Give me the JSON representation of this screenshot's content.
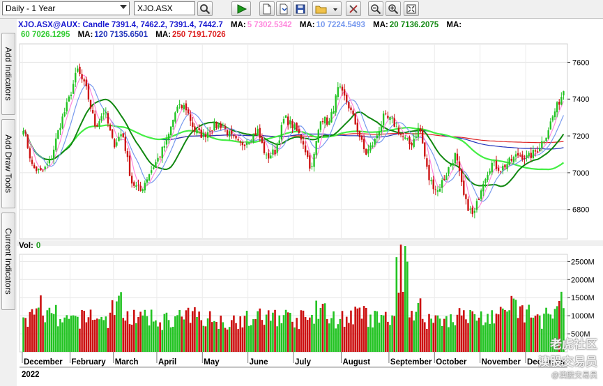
{
  "toolbar": {
    "period": "Daily - 1 Year",
    "symbol": "XJO.ASX"
  },
  "sidebar": {
    "tab1": "Add Indicators",
    "tab2": "Add Draw Tools",
    "tab3": "Current Indicators"
  },
  "legend": {
    "price": "XJO.ASX@AUX: Candle 7391.4, 7462.2, 7391.4, 7442.7",
    "ma5_label": "MA:",
    "ma5_value": "5 7302.5342",
    "ma10_label": "MA:",
    "ma10_value": "10 7224.5493",
    "ma20_label": "MA:",
    "ma20_value": "20 7136.2075",
    "ma_extra_label": "MA:",
    "ma60_value": "60 7026.1295",
    "ma120_label": "MA:",
    "ma120_value": "120 7135.6501",
    "ma250_label": "MA:",
    "ma250_value": "250 7191.7026",
    "volume": "Vol:",
    "volume_value": "0"
  },
  "watermark": {
    "text1": "老虎社区",
    "text2": "澳股交易员",
    "text3": "@澳股交易员"
  },
  "colors": {
    "up": "#22c322",
    "down": "#cc1111",
    "ma5": "#ff88dd",
    "ma10": "#7799ee",
    "ma20": "#118811",
    "ma60": "#44ee44",
    "ma120": "#2233bb",
    "ma250": "#dd2222"
  },
  "chart_data": {
    "type": "candlestick",
    "price_axis_ticks": [
      "7600",
      "7400",
      "7200",
      "7000",
      "6800"
    ],
    "price_axis_values": [
      7600,
      7400,
      7200,
      7000,
      6800
    ],
    "ylim": [
      6640,
      7700
    ],
    "volume_axis_ticks": [
      "2500M",
      "2000M",
      "1500M",
      "1000M",
      "500M"
    ],
    "volume_axis_values": [
      2500,
      2000,
      1500,
      1000,
      500
    ],
    "volume_ylim": [
      0,
      2700
    ],
    "months": [
      "December",
      "February",
      "March",
      "April",
      "May",
      "June",
      "July",
      "August",
      "September",
      "October",
      "November",
      "December"
    ],
    "year_label": "2022",
    "close_anchors": [
      7250,
      7030,
      7000,
      7060,
      7250,
      7390,
      7560,
      7450,
      7250,
      7340,
      7150,
      7220,
      6950,
      6900,
      7000,
      7080,
      7180,
      7350,
      7360,
      7230,
      7200,
      7250,
      7260,
      7200,
      7150,
      7180,
      7230,
      7080,
      7120,
      7300,
      7250,
      7180,
      7010,
      7300,
      7270,
      7460,
      7380,
      7250,
      7100,
      7170,
      7300,
      7280,
      7200,
      7150,
      7250,
      6970,
      6900,
      7000,
      7100,
      6850,
      6760,
      6950,
      7050,
      7020,
      7060,
      7100,
      7080,
      7120,
      7200,
      7330,
      7443
    ],
    "volume_profile": [
      900,
      1300,
      1000,
      800,
      900,
      1000,
      900,
      1300,
      1000,
      900,
      850,
      900,
      950,
      1000,
      900,
      850,
      900,
      900,
      950,
      1000,
      900,
      900,
      1100,
      900,
      950,
      1000,
      900,
      900,
      2300,
      1200,
      900,
      900,
      1000,
      950,
      950,
      1000,
      1200,
      1100,
      900,
      1000,
      1300
    ],
    "ma_series": [
      {
        "name": "MA 5",
        "value": 7302.5342
      },
      {
        "name": "MA 10",
        "value": 7224.5493
      },
      {
        "name": "MA 20",
        "value": 7136.2075
      },
      {
        "name": "MA 60",
        "value": 7026.1295
      },
      {
        "name": "MA 120",
        "value": 7135.6501
      },
      {
        "name": "MA 250",
        "value": 7191.7026
      }
    ]
  }
}
